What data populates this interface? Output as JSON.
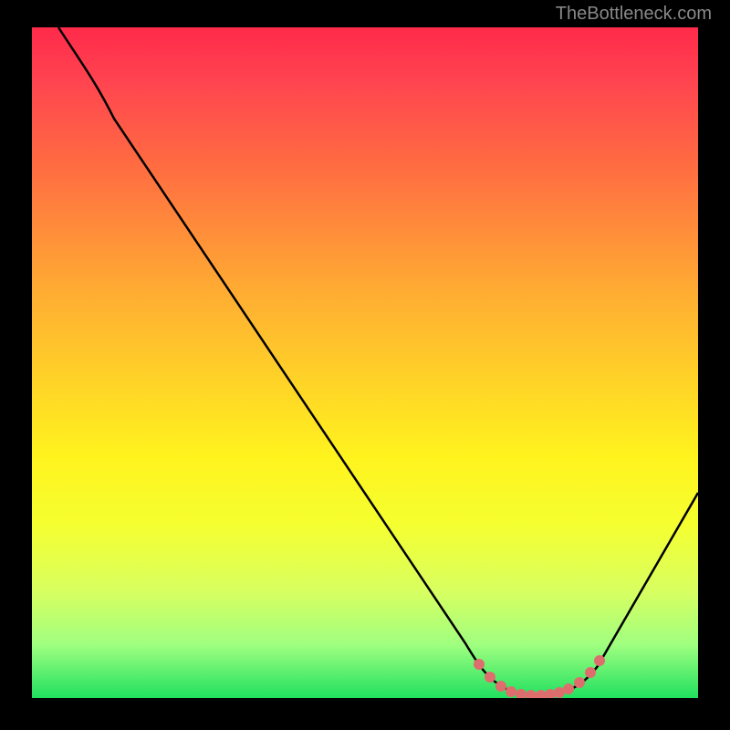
{
  "watermark": "TheBottleneck.com",
  "chart_data": {
    "type": "line",
    "title": "",
    "xlabel": "",
    "ylabel": "",
    "x_range": [
      0,
      100
    ],
    "y_range": [
      0,
      100
    ],
    "series": [
      {
        "name": "curve",
        "x": [
          4,
          10,
          20,
          30,
          40,
          50,
          60,
          65,
          68,
          70,
          72,
          75,
          78,
          80,
          82,
          85,
          90,
          95,
          100
        ],
        "y": [
          100,
          94,
          80,
          66,
          52,
          38,
          23,
          14,
          8,
          4,
          1,
          0.5,
          0.5,
          0.5,
          2,
          5,
          13,
          22,
          31
        ]
      }
    ],
    "markers": {
      "name": "bottom-dots",
      "color": "#e07070",
      "x": [
        67,
        69,
        71,
        73,
        74,
        75,
        76,
        77,
        78,
        79,
        80,
        82,
        84
      ],
      "y": [
        7,
        4,
        2,
        1,
        0.7,
        0.5,
        0.5,
        0.5,
        0.6,
        0.8,
        1.2,
        3,
        5
      ]
    },
    "background_gradient": {
      "type": "vertical",
      "stops": [
        {
          "pos": 0,
          "color": "#ff2a4a"
        },
        {
          "pos": 50,
          "color": "#ffd128"
        },
        {
          "pos": 75,
          "color": "#fff31e"
        },
        {
          "pos": 100,
          "color": "#20e060"
        }
      ]
    }
  }
}
